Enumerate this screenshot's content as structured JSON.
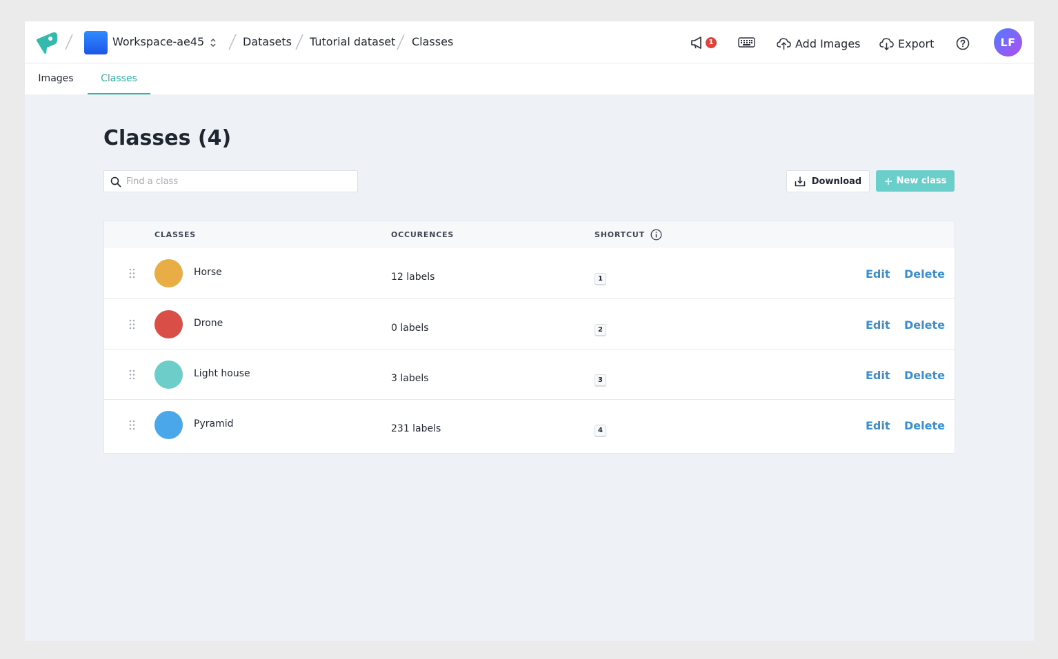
{
  "header": {
    "workspace": "Workspace-ae45",
    "breadcrumb": [
      "Datasets",
      "Tutorial dataset",
      "Classes"
    ],
    "notification_count": "1",
    "add_images_label": "Add Images",
    "export_label": "Export",
    "avatar_initials": "LF"
  },
  "tabs": [
    {
      "label": "Images",
      "active": false
    },
    {
      "label": "Classes",
      "active": true
    }
  ],
  "page": {
    "title": "Classes (4)",
    "search_placeholder": "Find a class",
    "download_label": "Download",
    "new_class_label": "New class"
  },
  "table": {
    "columns": {
      "classes": "CLASSES",
      "occurences": "OCCURENCES",
      "shortcut": "SHORTCUT"
    },
    "edit_label": "Edit",
    "delete_label": "Delete",
    "rows": [
      {
        "name": "Horse",
        "color": "#e8ad45",
        "occurrences": "12 labels",
        "shortcut": "1"
      },
      {
        "name": "Drone",
        "color": "#d94f48",
        "occurrences": "0 labels",
        "shortcut": "2"
      },
      {
        "name": "Light house",
        "color": "#6dcdc8",
        "occurrences": "3 labels",
        "shortcut": "3"
      },
      {
        "name": "Pyramid",
        "color": "#4aa8ea",
        "occurrences": "231 labels",
        "shortcut": "4"
      }
    ]
  },
  "colors": {
    "accent": "#2fb3a9",
    "primary_button": "#6acfca",
    "link": "#3a8ed0",
    "badge": "#e0433b"
  }
}
